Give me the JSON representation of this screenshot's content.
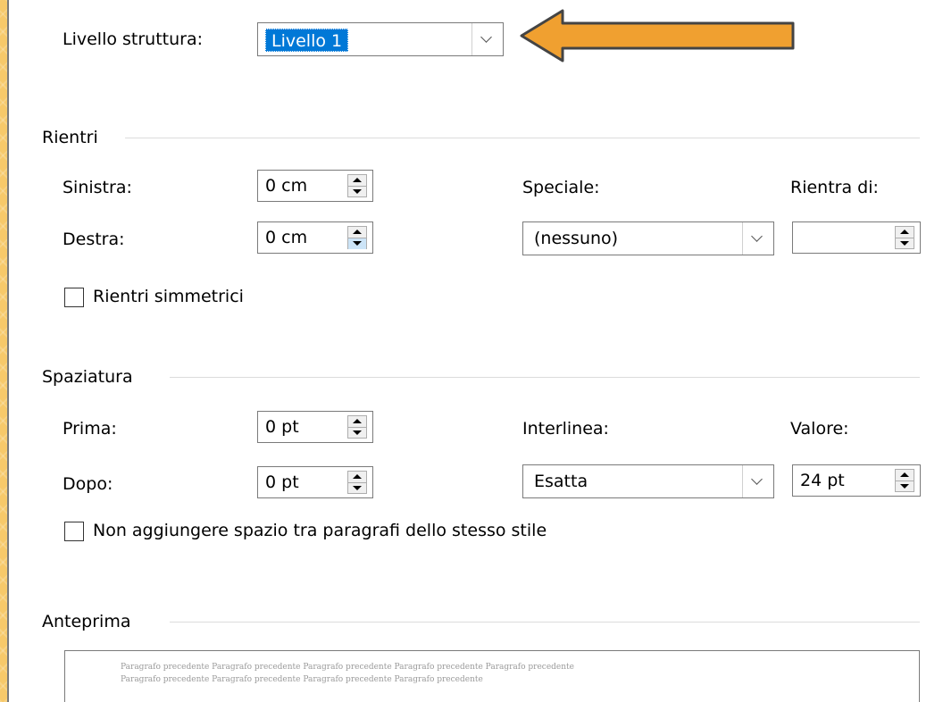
{
  "outline": {
    "label": "Livello struttura:",
    "value": "Livello 1"
  },
  "indent": {
    "section_title": "Rientri",
    "left_label": "Sinistra:",
    "left_value": "0 cm",
    "right_label": "Destra:",
    "right_value": "0 cm",
    "special_label": "Speciale:",
    "special_value": "(nessuno)",
    "by_label": "Rientra di:",
    "by_value": "",
    "mirror_label": "Rientri simmetrici"
  },
  "spacing": {
    "section_title": "Spaziatura",
    "before_label": "Prima:",
    "before_value": "0 pt",
    "after_label": "Dopo:",
    "after_value": "0 pt",
    "line_label": "Interlinea:",
    "line_value": "Esatta",
    "at_label": "Valore:",
    "at_value": "24 pt",
    "dont_add_label": "Non aggiungere spazio tra paragrafi dello stesso stile"
  },
  "preview": {
    "section_title": "Anteprima",
    "line1": "Paragrafo precedente Paragrafo precedente Paragrafo precedente Paragrafo precedente Paragrafo precedente",
    "line2": "Paragrafo precedente Paragrafo precedente Paragrafo precedente Paragrafo precedente"
  },
  "colors": {
    "arrow_fill": "#f0a030",
    "arrow_stroke": "#444444",
    "selection": "#0078d7"
  }
}
